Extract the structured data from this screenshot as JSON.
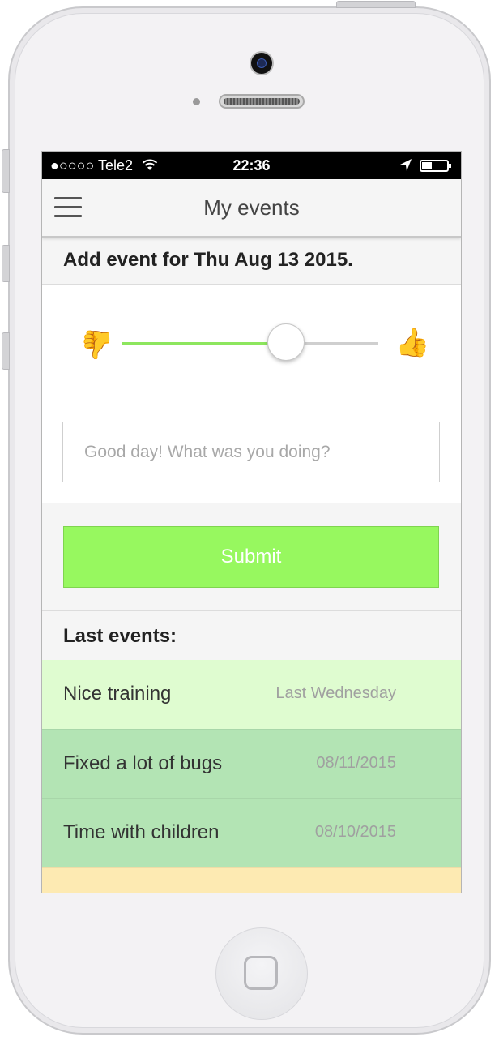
{
  "status_bar": {
    "carrier": "●○○○○ Tele2",
    "wifi_icon": "wifi-icon",
    "time": "22:36",
    "location_icon": "location-arrow-icon",
    "battery_level": 0.4
  },
  "navbar": {
    "title": "My events",
    "menu_icon": "hamburger-menu-icon"
  },
  "add_event": {
    "title": "Add event for Thu Aug 13 2015.",
    "mood_slider": {
      "value": 0.64,
      "left_icon": "thumbs-down-icon",
      "right_icon": "thumbs-up-icon"
    },
    "input_placeholder": "Good day! What was you doing?",
    "input_value": "",
    "submit_label": "Submit"
  },
  "last_events": {
    "title": "Last events:",
    "items": [
      {
        "name": "Nice training",
        "date": "Last Wednesday",
        "color": "#dffcd0"
      },
      {
        "name": "Fixed a lot of bugs",
        "date": "08/11/2015",
        "color": "#b3e4b4"
      },
      {
        "name": "Time with children",
        "date": "08/10/2015",
        "color": "#b3e4b4"
      },
      {
        "name": "",
        "date": "",
        "color": "#fdeab2"
      }
    ]
  },
  "colors": {
    "accent_green": "#97f85f",
    "slider_green": "#8de65e",
    "icon_green": "#86ec55"
  }
}
